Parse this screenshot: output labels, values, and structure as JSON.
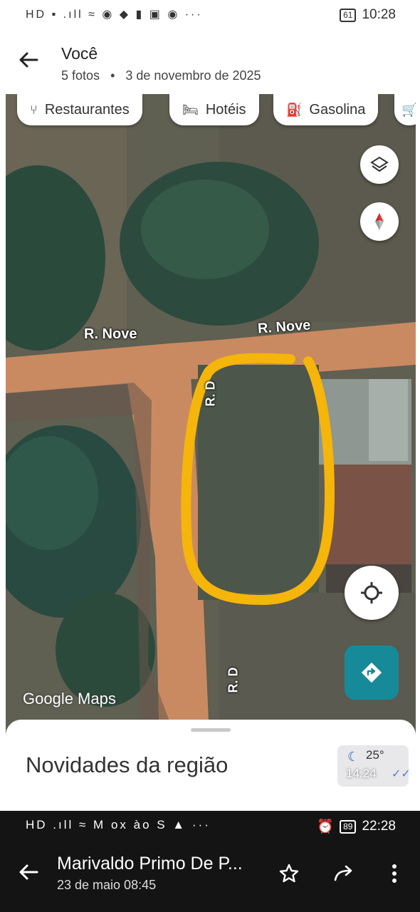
{
  "status_top": {
    "left_icons": "HD ▪ .ıll ≈ ◉ ◆ ▮ ▣ ◉ ···",
    "battery": "61",
    "time": "10:28"
  },
  "header": {
    "title": "Você",
    "photos": "5 fotos",
    "separator": "•",
    "date": "3 de novembro de 2025"
  },
  "map": {
    "chips": [
      {
        "icon": "restaurant-icon",
        "label": "Restaurantes"
      },
      {
        "icon": "hotel-icon",
        "label": "Hotéis"
      },
      {
        "icon": "gas-station-icon",
        "label": "Gasolina"
      }
    ],
    "streets": [
      "R. Nove",
      "R. Nove",
      "R. D",
      "R. D"
    ],
    "attribution": "Google Maps",
    "highlight_color": "#f5b50a",
    "directions_color": "#178a9a"
  },
  "sheet": {
    "title": "Novidades da região",
    "temperature": "25°",
    "time_overlay": "14:24"
  },
  "status_bottom": {
    "left_icons": "HD .ıll ≈ M ox ào S ▲ ···",
    "battery": "89",
    "time": "22:28"
  },
  "footer": {
    "sender": "Marivaldo Primo De P...",
    "date": "23 de maio 08:45"
  }
}
